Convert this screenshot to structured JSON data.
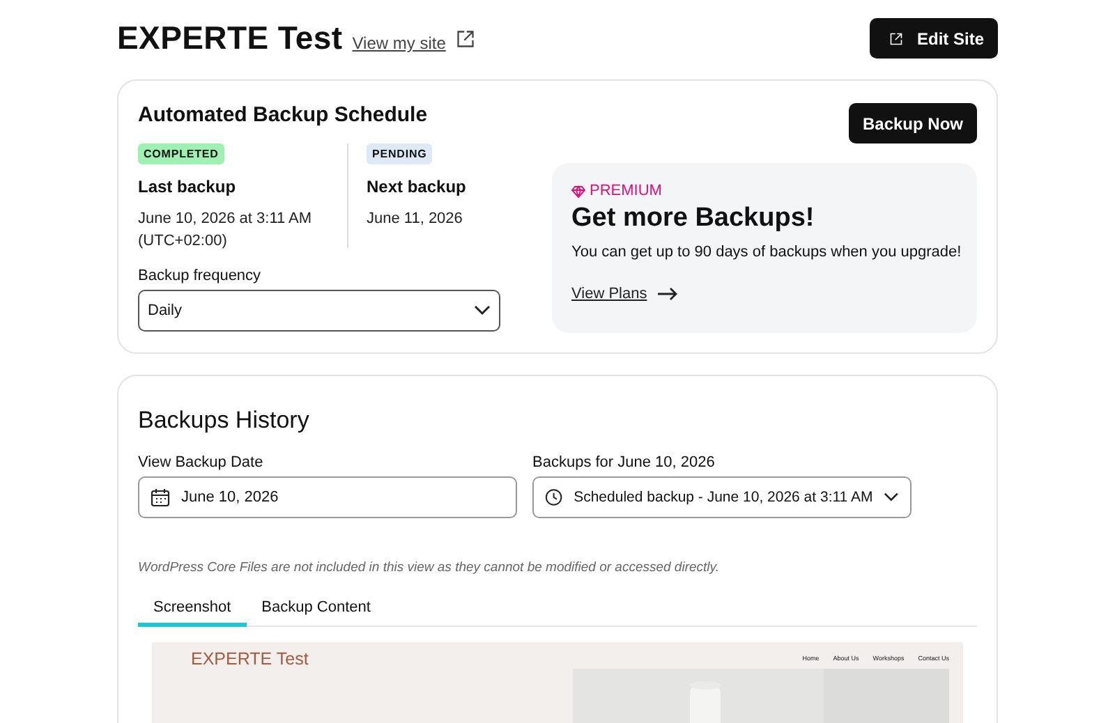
{
  "header": {
    "title": "EXPERTE Test",
    "view_link": "View my site",
    "edit_button": "Edit Site"
  },
  "schedule": {
    "title": "Automated Backup Schedule",
    "backup_now": "Backup Now",
    "status": [
      {
        "kind": "completed",
        "badge": "COMPLETED",
        "label": "Last backup",
        "date": "June 10, 2026 at 3:11 AM (UTC+02:00)"
      },
      {
        "kind": "pending",
        "badge": "PENDING",
        "label": "Next backup",
        "date": "June 11, 2026"
      }
    ],
    "frequency": {
      "label": "Backup frequency",
      "value": "Daily"
    },
    "premium": {
      "tag": "PREMIUM",
      "title": "Get more Backups!",
      "text": "You can get up to 90 days of backups when you upgrade!",
      "link": "View Plans"
    }
  },
  "history": {
    "title": "Backups History",
    "date_field": {
      "label": "View Backup Date",
      "value": "June 10, 2026"
    },
    "backup_select": {
      "label": "Backups for June 10, 2026",
      "value": "Scheduled backup - June 10, 2026 at 3:11 AM"
    },
    "note": "WordPress Core Files are not included in this view as they cannot be modified or accessed directly.",
    "tabs": [
      {
        "label": "Screenshot",
        "selected": true
      },
      {
        "label": "Backup Content",
        "selected": false
      }
    ],
    "preview": {
      "site_title": "EXPERTE Test",
      "nav": [
        "Home",
        "About Us",
        "Workshops",
        "Contact Us"
      ]
    }
  }
}
